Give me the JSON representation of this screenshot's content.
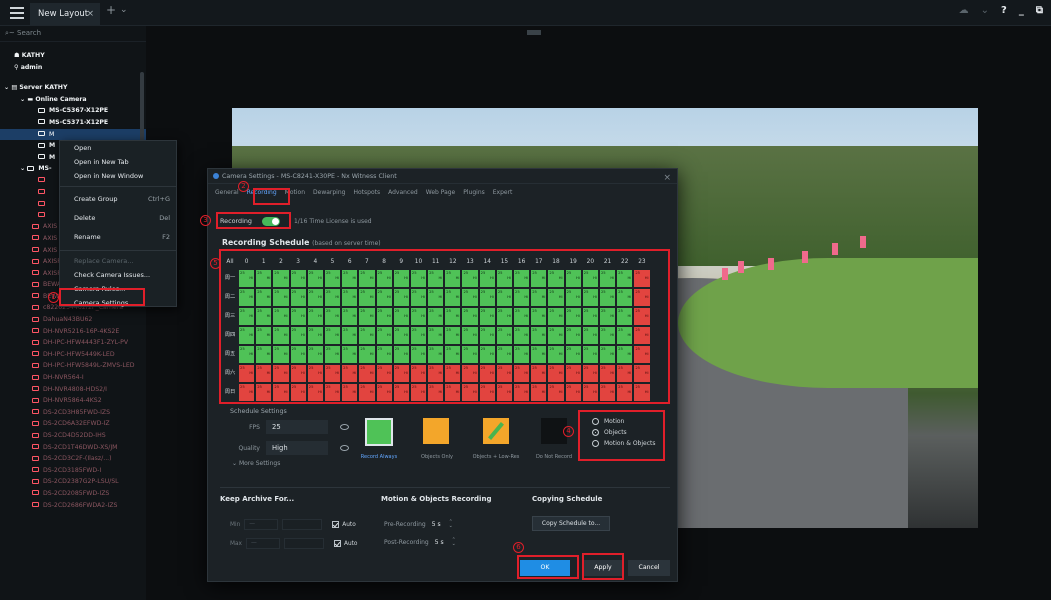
{
  "topbar": {
    "tab_label": "New Layout 1*",
    "tab_close": "×",
    "add_tab": "+",
    "tab_menu": "⌄",
    "help": "?",
    "minimize": "_",
    "restore": "⧉",
    "cloud": "☁",
    "cloud_menu": "⌄"
  },
  "sidebar": {
    "search_placeholder": "Search",
    "system": "KATHY",
    "user": "admin",
    "server": "Server KATHY",
    "online": "Online Camera",
    "items": [
      {
        "label": "MS-C5367-X12PE",
        "style": "bright"
      },
      {
        "label": "MS-C5371-X12PE",
        "style": "bright"
      },
      {
        "label": "M",
        "style": "sel"
      },
      {
        "label": "M",
        "style": "bright"
      },
      {
        "label": "M",
        "style": "bright"
      }
    ],
    "group_label": "MS-",
    "lower_items": [
      "AXIS",
      "AXIS",
      "AXIS",
      "AXISP1425LE",
      "AXISP3727PLE",
      "BEWARDSV3018DVZ",
      "BEWARDSV3210D",
      "c8220254462f2P_Camera",
      "DahuaN43BU62",
      "DH-NVR5216-16P-4KS2E",
      "DH-IPC-HFW4443F1-ZYL-PV",
      "DH-IPC-HFW5449K-LED",
      "DH-IPC-HFW5849L-ZMVS-LED",
      "DH-NVR564-I",
      "DH-NVR4808-HDS2/I",
      "DH-NVR5864-4KS2",
      "DS-2CD3H85FWD-IZS",
      "DS-2CD6A32EFWD-IZ",
      "DS-2CD4D52DD-IHS",
      "DS-2CD1T46DWD-XS/JM",
      "DS-2CD3C2F-(Ilasz/...)",
      "DS-2CD3185FWD-I",
      "DS-2CD2387G2P-LSU/SL",
      "DS-2CD2085FWD-IZS",
      "DS-2CD2686FWDA2-IZS"
    ]
  },
  "context_menu": {
    "items": [
      {
        "label": "Open",
        "shortcut": ""
      },
      {
        "label": "Open in New Tab",
        "shortcut": ""
      },
      {
        "label": "Open in New Window",
        "shortcut": ""
      },
      {
        "label": "Create Group",
        "shortcut": "Ctrl+G"
      },
      {
        "label": "Delete",
        "shortcut": "Del"
      },
      {
        "label": "Rename",
        "shortcut": "F2"
      },
      {
        "label": "Replace Camera...",
        "shortcut": ""
      },
      {
        "label": "Check Camera Issues...",
        "shortcut": ""
      },
      {
        "label": "Camera Rules...",
        "shortcut": ""
      },
      {
        "label": "Camera Settings...",
        "shortcut": ""
      }
    ]
  },
  "dialog": {
    "title": "Camera Settings - MS-C8241-X30PE - Nx Witness Client",
    "tabs": [
      "General",
      "Recording",
      "Motion",
      "Dewarping",
      "Hotspots",
      "Advanced",
      "Web Page",
      "Plugins",
      "Expert"
    ],
    "active_tab": "Recording",
    "recording_label": "Recording",
    "license_text": "1/16 Time License is used",
    "schedule_title": "Recording Schedule",
    "schedule_note": "(based on server time)",
    "grid_all": "All",
    "hours": [
      "0",
      "1",
      "2",
      "3",
      "4",
      "5",
      "6",
      "7",
      "8",
      "9",
      "10",
      "11",
      "12",
      "13",
      "14",
      "15",
      "16",
      "17",
      "18",
      "19",
      "20",
      "21",
      "22",
      "23"
    ],
    "days": [
      "周一",
      "周二",
      "周三",
      "周四",
      "周五",
      "周六",
      "周日"
    ],
    "cell_fps": "25",
    "cell_quality": "Hi",
    "schedule_settings": "Schedule Settings",
    "fps_label": "FPS",
    "fps_value": "25",
    "quality_label": "Quality",
    "quality_value": "High",
    "more_settings": "More Settings",
    "modes": [
      "Record Always",
      "Objects Only",
      "Objects + Low-Res",
      "Do Not Record"
    ],
    "radio": [
      "Motion",
      "Objects",
      "Motion & Objects"
    ],
    "archive_title": "Keep Archive For...",
    "min_label": "Min",
    "max_label": "Max",
    "dash": "—",
    "auto": "Auto",
    "motion_title": "Motion & Objects Recording",
    "pre_label": "Pre-Recording",
    "post_label": "Post-Recording",
    "pre_value": "5 s",
    "post_value": "5 s",
    "copy_title": "Copying Schedule",
    "copy_btn": "Copy Schedule to...",
    "ok": "OK",
    "apply": "Apply",
    "cancel": "Cancel"
  },
  "annotations": [
    "1",
    "2",
    "3",
    "4",
    "5",
    "6"
  ],
  "colors": {
    "accent": "#1f8de4",
    "schedule_green": "#4fc257",
    "schedule_red": "#e2443f",
    "annotation": "#e01f2a"
  }
}
